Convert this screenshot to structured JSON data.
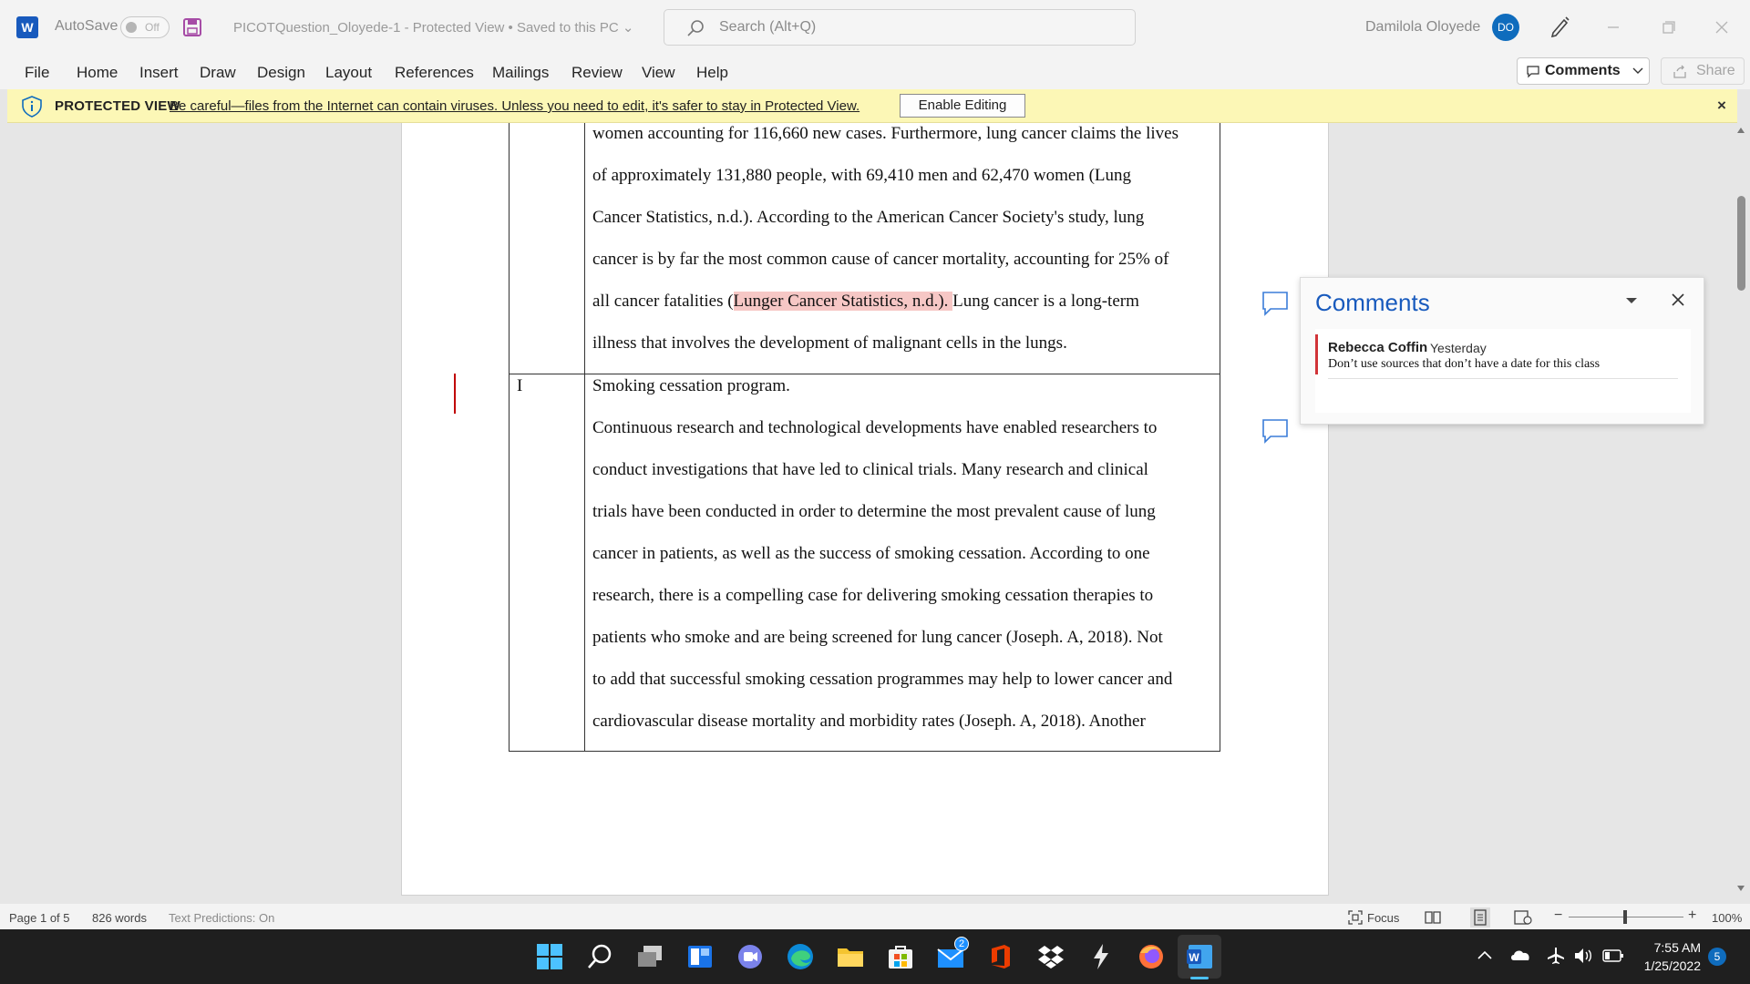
{
  "titlebar": {
    "autosave_label": "AutoSave",
    "autosave_state": "Off",
    "document_title": "PICOTQuestion_Oloyede-1  -  Protected View • Saved to this PC",
    "search_placeholder": "Search (Alt+Q)",
    "user_name": "Damilola  Oloyede",
    "user_initials": "DO"
  },
  "ribbon": {
    "tabs": [
      "File",
      "Home",
      "Insert",
      "Draw",
      "Design",
      "Layout",
      "References",
      "Mailings",
      "Review",
      "View",
      "Help"
    ],
    "comments_label": "Comments",
    "share_label": "Share"
  },
  "protected_view": {
    "title": "PROTECTED VIEW",
    "message": "Be careful—files from the Internet can contain viruses. Unless you need to edit, it's safer to stay in Protected View.",
    "enable_button": "Enable Editing",
    "close": "×"
  },
  "document": {
    "upper_lines": [
      "women accounting for 116,660 new cases. Furthermore, lung cancer claims the lives",
      "of approximately 131,880 people, with 69,410 men and 62,470 women (Lung",
      "Cancer Statistics, n.d.). According to the American Cancer Society's study, lung",
      "cancer is by far the most common cause of cancer mortality, accounting for 25% of"
    ],
    "highlight_line": {
      "before": "all cancer fatalities (",
      "highlighted": "Lunger Cancer Statistics, n.d.). ",
      "after": "Lung cancer is a long-term"
    },
    "upper_last_line": "illness that involves the development of malignant cells in the lungs.",
    "row_label": "I",
    "row_heading": "Smoking cessation program.",
    "lower_lines": [
      "Continuous research and technological developments have enabled researchers to",
      "conduct investigations that have led to clinical trials. Many research and clinical",
      "trials have been conducted in order to determine the most prevalent cause of lung",
      "cancer in patients, as well as the success of smoking cessation. According to one",
      "research, there is a compelling case for delivering smoking cessation therapies to",
      "patients who smoke and are being screened for lung cancer (Joseph. A, 2018). Not",
      "to add that successful smoking cessation programmes may help to lower cancer and",
      "cardiovascular disease mortality and morbidity rates (Joseph. A, 2018). Another"
    ]
  },
  "comments_pane": {
    "header": "Comments",
    "comment": {
      "author": "Rebecca Coffin",
      "time": "Yesterday",
      "text": "Don’t use sources that don’t have a date for this class"
    }
  },
  "statusbar": {
    "page": "Page 1 of 5",
    "words": "826 words",
    "predictions": "Text Predictions: On",
    "focus": "Focus",
    "zoom": "100%"
  },
  "taskbar": {
    "time": "7:55 AM",
    "date": "1/25/2022",
    "mail_badge": "2",
    "notification_count": "5"
  },
  "colors": {
    "word_blue": "#185abd",
    "protected_yellow": "#fcf7b6",
    "highlight": "#f6c7c5",
    "comment_red": "#d13438"
  }
}
